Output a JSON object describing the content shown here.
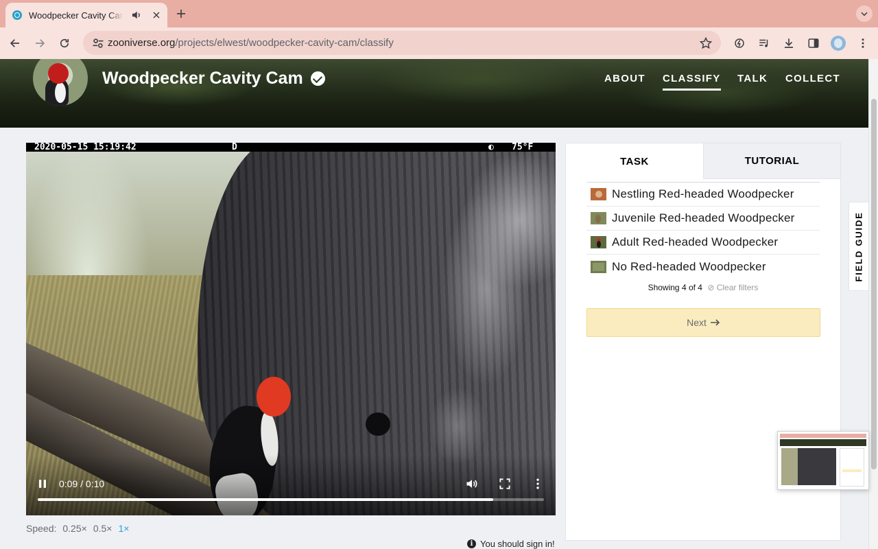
{
  "browser": {
    "tab_title": "Woodpecker Cavity Cam",
    "url_host": "zooniverse.org",
    "url_path": "/projects/elwest/woodpecker-cavity-cam/classify"
  },
  "project": {
    "title": "Woodpecker Cavity Cam",
    "nav": [
      "ABOUT",
      "CLASSIFY",
      "TALK",
      "COLLECT"
    ],
    "active_nav": "CLASSIFY"
  },
  "video": {
    "timestamp": "2020-05-15 15:19:42",
    "mode": "D",
    "temperature": "75°F",
    "time_display": "0:09 / 0:10",
    "progress": 0.9
  },
  "speed": {
    "label": "Speed:",
    "options": [
      "0.25×",
      "0.5×",
      "1×"
    ],
    "selected": "1×"
  },
  "signin_notice": "You should sign in!",
  "task_panel": {
    "tabs": [
      "TASK",
      "TUTORIAL"
    ],
    "choices": [
      {
        "label": "Nestling Red-headed Woodpecker",
        "thumb_color": "#b86a3a"
      },
      {
        "label": "Juvenile Red-headed Woodpecker",
        "thumb_color": "#7e8a5a"
      },
      {
        "label": "Adult Red-headed Woodpecker",
        "thumb_color": "#5d6a3e"
      },
      {
        "label": "No Red-headed Woodpecker",
        "thumb_color": "#6f7c52"
      }
    ],
    "showing": "Showing 4 of 4",
    "clear_filters": "Clear filters",
    "next_label": "Next",
    "field_guide": "FIELD GUIDE"
  },
  "colors": {
    "accent_blue": "#2d9cdb",
    "next_button_bg": "#fbecc0",
    "tab_strip": "#e8ada3"
  }
}
